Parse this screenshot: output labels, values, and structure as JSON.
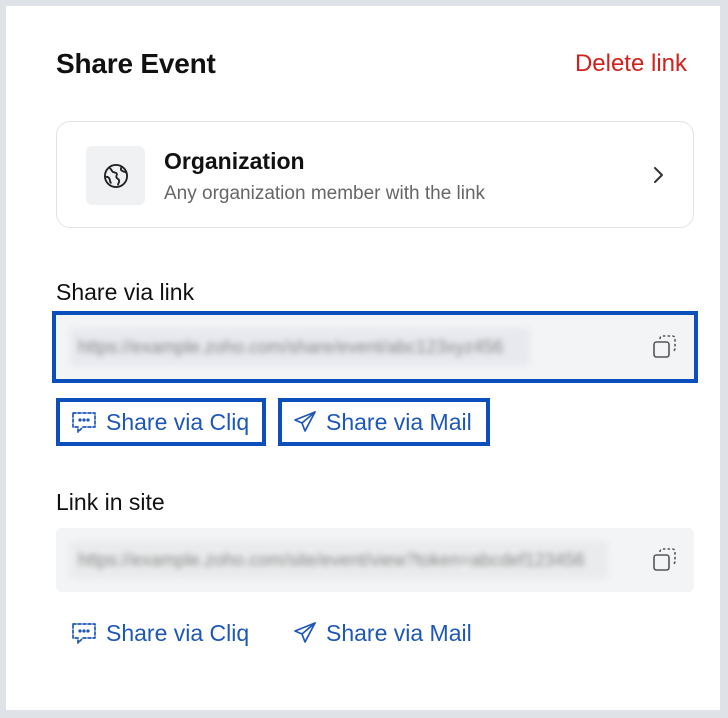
{
  "header": {
    "title": "Share Event",
    "delete_label": "Delete link"
  },
  "access": {
    "title": "Organization",
    "subtitle": "Any organization member with the link",
    "icon": "globe-icon"
  },
  "share_via_link": {
    "label": "Share via link",
    "url_blurred": "https://example.zoho.com/share/event/abc123xyz456",
    "cliq_label": "Share via Cliq",
    "mail_label": "Share via Mail"
  },
  "link_in_site": {
    "label": "Link in site",
    "url_blurred": "https://example.zoho.com/site/event/view?token=abcdef123456",
    "cliq_label": "Share via Cliq",
    "mail_label": "Share via Mail"
  },
  "colors": {
    "accent": "#1d57b7",
    "highlight": "#0a4fbb",
    "danger": "#d0211c"
  }
}
